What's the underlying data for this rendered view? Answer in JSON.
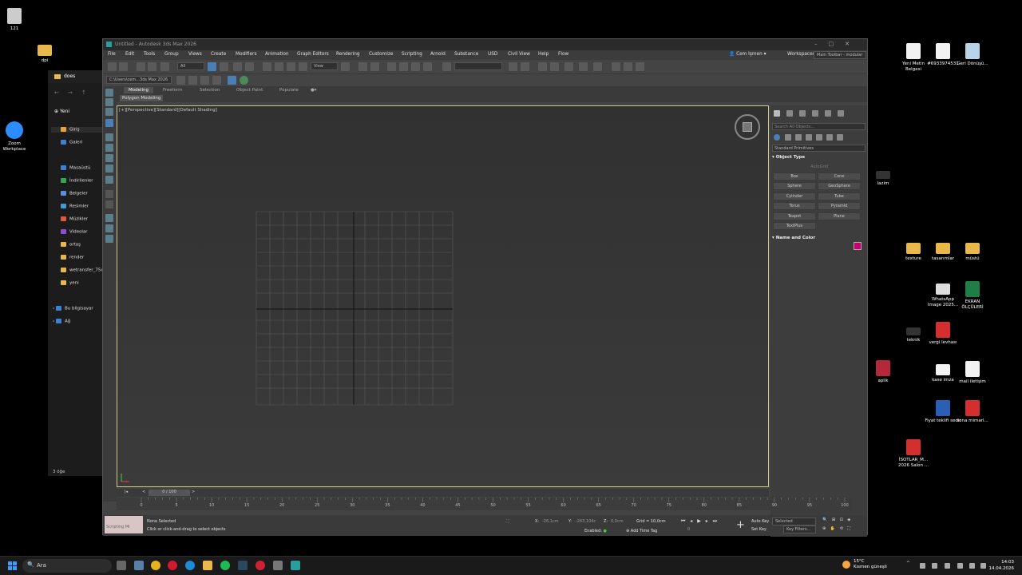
{
  "desktop": {
    "left_icons": [
      {
        "label": "121",
        "kind": "doc"
      },
      {
        "label": "dpi",
        "kind": "folder"
      },
      {
        "label": "Zoom Workplace",
        "kind": "zoom"
      }
    ],
    "right_icons": [
      {
        "label": "Yeni Metin Belgesi",
        "kind": "doc"
      },
      {
        "label": "#6933974531",
        "kind": "doc"
      },
      {
        "label": "Geri Dönüşü...",
        "kind": "recycle"
      },
      {
        "label": "lazim",
        "kind": "dark"
      },
      {
        "label": "texture",
        "kind": "folder"
      },
      {
        "label": "tasarımlar",
        "kind": "folder"
      },
      {
        "label": "müstü",
        "kind": "folder"
      },
      {
        "label": "WhatsApp Image 2025...",
        "kind": "doc"
      },
      {
        "label": "EKRAN ÖLÇÜLERİ",
        "kind": "xls"
      },
      {
        "label": "teknik",
        "kind": "dark"
      },
      {
        "label": "vergi levhası",
        "kind": "pdf"
      },
      {
        "label": "aplik",
        "kind": "access"
      },
      {
        "label": "kase imza",
        "kind": "doc"
      },
      {
        "label": "mail iletişim",
        "kind": "doc"
      },
      {
        "label": "Fiyat teklifi sedir",
        "kind": "word"
      },
      {
        "label": "sona mimarl...",
        "kind": "pdf"
      },
      {
        "label": "İSOTLAR_M... 2026 Salon ...",
        "kind": "pdf"
      }
    ]
  },
  "explorer": {
    "tab_title": "does",
    "new_label": "Yeni",
    "items": [
      {
        "label": "Giriş",
        "color": "#e8a33a"
      },
      {
        "label": "Galeri",
        "color": "#3b82d6"
      },
      {
        "label": "Masaüstü",
        "color": "#3b82d6"
      },
      {
        "label": "İndirilenler",
        "color": "#2fa84f"
      },
      {
        "label": "Belgeler",
        "color": "#5b8ede"
      },
      {
        "label": "Resimler",
        "color": "#3b9cd6"
      },
      {
        "label": "Müzikler",
        "color": "#e05a3a"
      },
      {
        "label": "Videolar",
        "color": "#8a4fd6"
      },
      {
        "label": "ortaş",
        "color": "#e8b84a"
      },
      {
        "label": "render",
        "color": "#e8b84a"
      },
      {
        "label": "wetransfer_75x1",
        "color": "#e8b84a"
      },
      {
        "label": "yeni",
        "color": "#e8b84a"
      },
      {
        "label": "Bu bilgisayar",
        "color": "#3b82d6"
      },
      {
        "label": "Ağ",
        "color": "#3b82d6"
      }
    ],
    "item_count": "3 öğe"
  },
  "max": {
    "title": "Untitled - Autodesk 3ds Max 2026",
    "menus": [
      "File",
      "Edit",
      "Tools",
      "Group",
      "Views",
      "Create",
      "Modifiers",
      "Animation",
      "Graph Editors",
      "Rendering",
      "Customize",
      "Scripting",
      "Arnold",
      "Substance",
      "USD",
      "Civil View",
      "Help",
      "Flow"
    ],
    "user": "Cem Işmen",
    "workspace_label": "Workspaces:",
    "workspace_value": "Main Toolbar - modular",
    "selection_filter": "All",
    "ref_coord": "View",
    "path": "C:\\Users\\cem...3ds Max 2026",
    "ribbon_tabs": [
      "Modeling",
      "Freeform",
      "Selection",
      "Object Paint",
      "Populate"
    ],
    "ribbon_subtab": "Polygon Modeling",
    "viewport_label": "[+][Perspective][Standard][Default Shading]",
    "command_panel": {
      "search_placeholder": "Search All Objects...",
      "category": "Standard Primitives",
      "object_type_title": "Object Type",
      "autogrid": "AutoGrid",
      "buttons": [
        "Box",
        "Cone",
        "Sphere",
        "GeoSphere",
        "Cylinder",
        "Tube",
        "Torus",
        "Pyramid",
        "Teapot",
        "Plane",
        "TextPlus"
      ],
      "name_color_title": "Name and Color",
      "color": "#c8006e"
    },
    "time_slider": "0 / 100",
    "ruler_ticks": [
      "0",
      "5",
      "10",
      "15",
      "20",
      "25",
      "30",
      "35",
      "40",
      "45",
      "50",
      "55",
      "60",
      "65",
      "70",
      "75",
      "80",
      "85",
      "90",
      "95",
      "100"
    ],
    "status": {
      "maxscript": "Scripting Mi",
      "selected": "None Selected",
      "prompt": "Click or click-and-drag to select objects",
      "x_label": "X:",
      "x_value": "-26,1cm",
      "y_label": "Y:",
      "y_value": "-263,104c",
      "z_label": "Z:",
      "z_value": "0,0cm",
      "grid": "Grid = 10,0cm",
      "enabled": "Enabled:",
      "add_time_tag": "Add Time Tag",
      "auto_key": "Auto Key",
      "set_key": "Set Key",
      "key_mode": "Selected",
      "key_filters": "Key Filters..."
    }
  },
  "taskbar": {
    "search_label": "Ara",
    "weather_temp": "15°C",
    "weather_desc": "Kısmen güneşli",
    "time": "14:03",
    "date": "14.04.2026"
  }
}
